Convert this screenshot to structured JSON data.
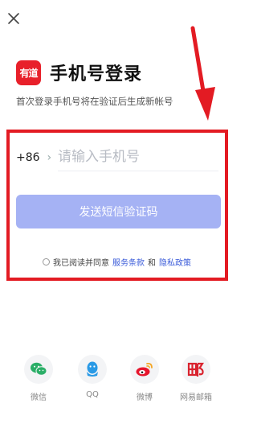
{
  "header": {
    "logo_text": "有道",
    "title": "手机号登录",
    "subtitle": "首次登录手机号将在验证后生成新帐号"
  },
  "form": {
    "country_code": "+86",
    "phone_placeholder": "请输入手机号",
    "send_button": "发送短信验证码",
    "agree_prefix": "我已阅读并同意",
    "terms_link": "服务条款",
    "and_text": "和",
    "privacy_link": "隐私政策"
  },
  "social": [
    {
      "label": "微信",
      "icon": "wechat-icon"
    },
    {
      "label": "QQ",
      "icon": "qq-icon"
    },
    {
      "label": "微博",
      "icon": "weibo-icon"
    },
    {
      "label": "网易邮箱",
      "icon": "netease-mail-icon"
    }
  ],
  "colors": {
    "brand_red": "#e8202a",
    "button": "#a5b2f4",
    "link": "#3a5bd9",
    "annotation_red": "#e31b23"
  }
}
